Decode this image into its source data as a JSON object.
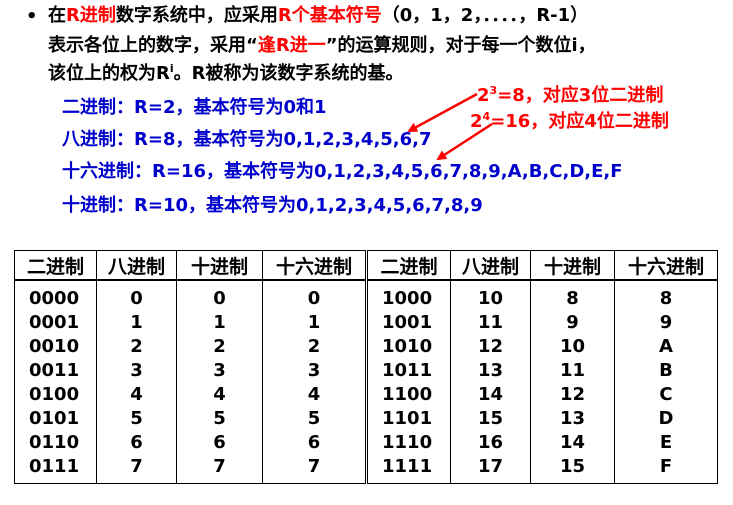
{
  "intro": {
    "bullet": "•",
    "line1": {
      "p1": "在",
      "p2": "R进制",
      "p3": "数字系统中，应采用",
      "p4": "R个基本符号",
      "p5": "（0，1，2，．．．．，R-1）"
    },
    "line2": {
      "p1": "表示各位上的数字，采用“",
      "p2": "逢R进一",
      "p3": "”的运算规则，对于每一个数位i，"
    },
    "line3": {
      "p1": "该位上的权为R",
      "sup": "i",
      "p2": "。R被称为该数字系统的基。"
    }
  },
  "systems": {
    "binary": "二进制：R=2，基本符号为0和1",
    "octal": "八进制：R=8，基本符号为0,1,2,3,4,5,6,7",
    "hex": "十六进制：R=16，基本符号为0,1,2,3,4,5,6,7,8,9,A,B,C,D,E,F",
    "decimal": "十进制：R=10，基本符号为0,1,2,3,4,5,6,7,8,9"
  },
  "annotations": {
    "note1_base": "2",
    "note1_exp": "3",
    "note1_rest": "=8，对应3位二进制",
    "note2_base": "2",
    "note2_exp": "4",
    "note2_rest": "=16，对应4位二进制"
  },
  "table": {
    "headers": [
      "二进制",
      "八进制",
      "十进制",
      "十六进制",
      "二进制",
      "八进制",
      "十进制",
      "十六进制"
    ],
    "rows": [
      [
        "0000",
        "0",
        "0",
        "0",
        "1000",
        "10",
        "8",
        "8"
      ],
      [
        "0001",
        "1",
        "1",
        "1",
        "1001",
        "11",
        "9",
        "9"
      ],
      [
        "0010",
        "2",
        "2",
        "2",
        "1010",
        "12",
        "10",
        "A"
      ],
      [
        "0011",
        "3",
        "3",
        "3",
        "1011",
        "13",
        "11",
        "B"
      ],
      [
        "0100",
        "4",
        "4",
        "4",
        "1100",
        "14",
        "12",
        "C"
      ],
      [
        "0101",
        "5",
        "5",
        "5",
        "1101",
        "15",
        "13",
        "D"
      ],
      [
        "0110",
        "6",
        "6",
        "6",
        "1110",
        "16",
        "14",
        "E"
      ],
      [
        "0111",
        "7",
        "7",
        "7",
        "1111",
        "17",
        "15",
        "F"
      ]
    ]
  },
  "colors": {
    "red": "#ff0000",
    "blue": "#0000cc",
    "text": "#000000"
  }
}
